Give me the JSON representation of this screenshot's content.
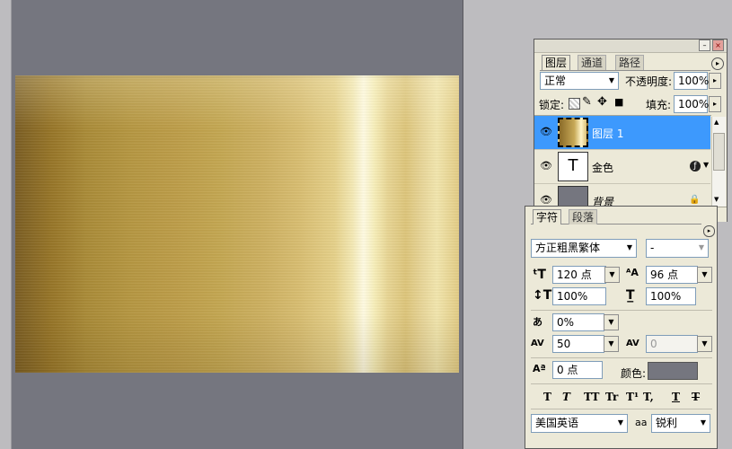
{
  "layers_panel": {
    "tabs": [
      "图层",
      "通道",
      "路径"
    ],
    "blend_mode": "正常",
    "opacity_label": "不透明度:",
    "opacity_value": "100%",
    "lock_label": "锁定:",
    "fill_label": "填充:",
    "fill_value": "100%",
    "layers": [
      {
        "name": "图层 1",
        "selected": true
      },
      {
        "name": "金色",
        "type_glyph": "T"
      },
      {
        "name": "背景"
      }
    ]
  },
  "character_panel": {
    "tabs": [
      "字符",
      "段落"
    ],
    "font_family": "方正粗黑繁体",
    "font_style": "-",
    "font_size": "120 点",
    "leading": "96 点",
    "vertical_scale": "100%",
    "horizontal_scale": "100%",
    "tsume": "0%",
    "tracking": "50",
    "kerning": "0",
    "baseline_shift": "0 点",
    "color_label": "颜色:",
    "color_value": "#75767f",
    "language": "美国英语",
    "aa_label": "aa",
    "antialias": "锐利",
    "style_buttons": [
      "T",
      "T",
      "TT",
      "Tr",
      "T¹",
      "T,",
      "T",
      "T"
    ]
  },
  "colors": {
    "workspace": "#75767f",
    "panel_bg": "#ece9d8",
    "selection": "#3d99fd"
  }
}
